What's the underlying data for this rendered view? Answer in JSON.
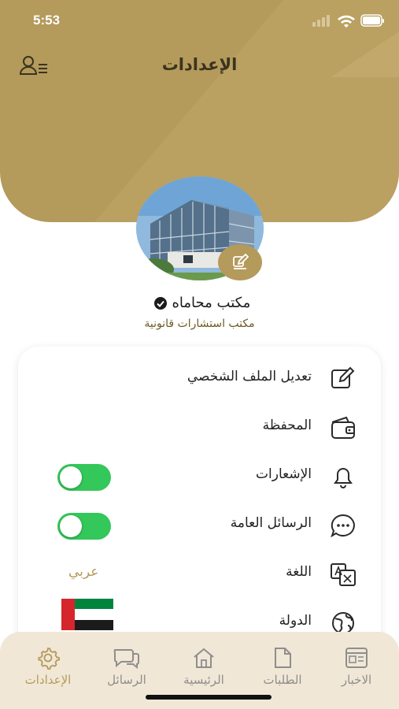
{
  "status_bar": {
    "time": "5:53"
  },
  "header": {
    "title": "الإعدادات",
    "user_list_icon": "user-list-icon"
  },
  "profile": {
    "name": "مكتب محاماه",
    "subtitle": "مكتب استشارات قانونية",
    "verified_icon": "verified-check-icon",
    "edit_icon": "pencil-edit-icon"
  },
  "menu": {
    "edit_profile": "تعديل الملف الشخصي",
    "wallet": "المحفظة",
    "notifications": "الإشعارات",
    "public_messages": "الرسائل العامة",
    "language": "اللغة",
    "language_value": "عربي",
    "country": "الدولة",
    "notifications_enabled": true,
    "public_messages_enabled": true
  },
  "tabbar": {
    "tabs": [
      {
        "label": "الاخبار",
        "icon": "news-icon"
      },
      {
        "label": "الطلبات",
        "icon": "document-icon"
      },
      {
        "label": "الرئيسية",
        "icon": "home-icon"
      },
      {
        "label": "الرسائل",
        "icon": "chat-icon"
      },
      {
        "label": "الإعدادات",
        "icon": "gear-icon"
      }
    ],
    "active": "الإعدادات"
  },
  "colors": {
    "accent": "#b49a5b",
    "header_bg": "#b49a5b",
    "toggle_on": "#34c759",
    "tabbar_bg": "#f1e7d6"
  }
}
